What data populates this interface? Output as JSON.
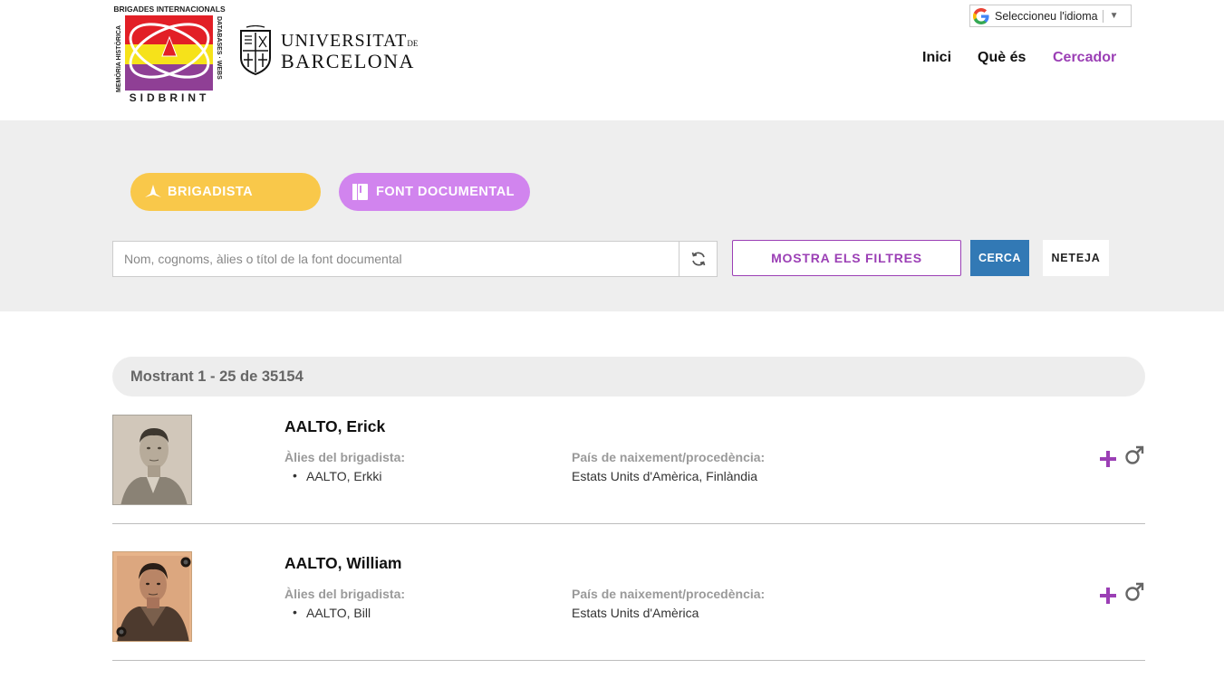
{
  "header": {
    "logo_sidbrint": {
      "top": "BRIGADES INTERNACIONALS",
      "left": "MEMÒRIA HISTÒRICA",
      "right": "DATABASES · WEBS",
      "bottom": "SIDBRINT"
    },
    "logo_ub": {
      "line1": "UNIVERSITAT",
      "line1_small": "DE",
      "line2": "BARCELONA"
    },
    "language_selector": "Seleccioneu l'idioma",
    "nav": {
      "inici": "Inici",
      "que_es": "Què és",
      "cercador": "Cercador"
    }
  },
  "search": {
    "tab_brigadista": "BRIGADISTA",
    "tab_font": "FONT DOCUMENTAL",
    "placeholder": "Nom, cognoms, àlies o títol de la font documental",
    "value": "",
    "filters_label": "MOSTRA ELS FILTRES",
    "cerca_label": "CERCA",
    "neteja_label": "NETEJA"
  },
  "results": {
    "count_text": "Mostrant 1 - 25 de 35154",
    "alias_label": "Àlies del brigadista:",
    "country_label": "País de naixement/procedència:",
    "items": [
      {
        "name": "AALTO, Erick",
        "alias": "AALTO, Erkki",
        "country": "Estats Units d'Amèrica, Finlàndia"
      },
      {
        "name": "AALTO, William",
        "alias": "AALTO, Bill",
        "country": "Estats Units d'Amèrica"
      }
    ]
  },
  "colors": {
    "accent_purple": "#9b3fb5",
    "brigadista_yellow": "#f9c84a",
    "font_lilac": "#d184ee",
    "cerca_blue": "#3279b5"
  }
}
